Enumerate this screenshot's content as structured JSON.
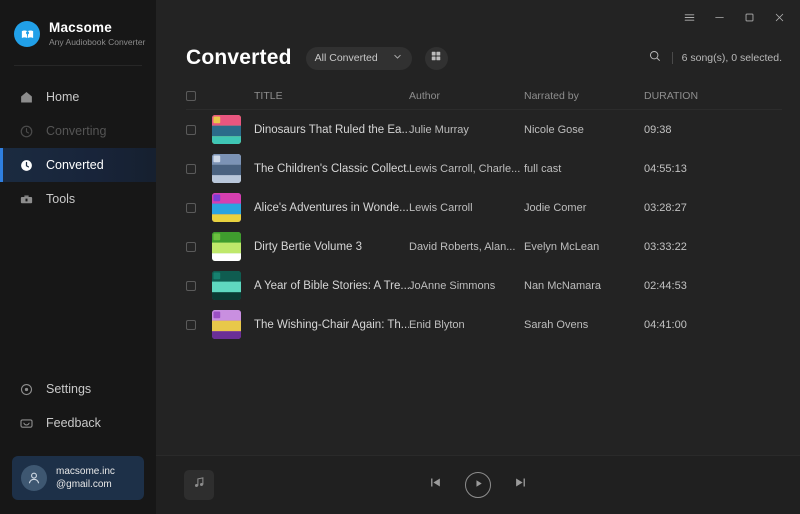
{
  "window": {
    "controls": [
      {
        "name": "menu",
        "glyph": "menu-icon"
      },
      {
        "name": "minimize",
        "glyph": "minimize-icon"
      },
      {
        "name": "maximize",
        "glyph": "maximize-icon"
      },
      {
        "name": "close",
        "glyph": "close-icon"
      }
    ]
  },
  "brand": {
    "name": "Macsome",
    "subtitle": "Any Audiobook Converter",
    "logo_icon": "audiobook-logo-icon",
    "accent": "#21a0e8"
  },
  "sidebar": {
    "items": [
      {
        "label": "Home",
        "icon": "home-icon",
        "state": "normal"
      },
      {
        "label": "Converting",
        "icon": "converting-icon",
        "state": "disabled"
      },
      {
        "label": "Converted",
        "icon": "clock-icon",
        "state": "active"
      },
      {
        "label": "Tools",
        "icon": "toolbox-icon",
        "state": "normal"
      }
    ],
    "bottom_items": [
      {
        "label": "Settings",
        "icon": "gear-icon"
      },
      {
        "label": "Feedback",
        "icon": "feedback-icon"
      }
    ],
    "account": {
      "line1": "macsome.inc",
      "line2": "@gmail.com",
      "avatar_icon": "user-avatar-icon"
    },
    "active_accent": "#2f7fe0"
  },
  "header": {
    "title": "Converted",
    "filter": {
      "selected": "All Converted",
      "chevron_icon": "chevron-down-icon"
    },
    "grid_view_icon": "grid-view-icon",
    "search_icon": "search-icon",
    "count_text": "6 song(s), 0 selected."
  },
  "table": {
    "columns": [
      "TITLE",
      "Author",
      "Narrated by",
      "DURATION"
    ],
    "select_all_checked": false,
    "rows": [
      {
        "title": "Dinosaurs That Ruled the Ea...",
        "author": "Julie Murray",
        "narrated_by": "Nicole Gose",
        "duration": "09:38",
        "checked": false,
        "art": {
          "c1": "#e8c84a",
          "c2": "#e8567f",
          "c3": "#2b6b8a",
          "c4": "#3fc6b5"
        }
      },
      {
        "title": "The Children's Classic Collect...",
        "author": "Lewis Carroll, Charle...",
        "narrated_by": "full cast",
        "duration": "04:55:13",
        "checked": false,
        "art": {
          "c1": "#cfd9e8",
          "c2": "#7c93b5",
          "c3": "#4a6280",
          "c4": "#b9c7da"
        }
      },
      {
        "title": "Alice's Adventures in Wonde...",
        "author": "Lewis Carroll",
        "narrated_by": "Jodie Comer",
        "duration": "03:28:27",
        "checked": false,
        "art": {
          "c1": "#7a3fd6",
          "c2": "#d63fb0",
          "c3": "#2aa3e0",
          "c4": "#e8d23f"
        }
      },
      {
        "title": "Dirty Bertie Volume 3",
        "author": "David Roberts, Alan...",
        "narrated_by": "Evelyn McLean",
        "duration": "03:33:22",
        "checked": false,
        "art": {
          "c1": "#6bbf3f",
          "c2": "#3f9c2e",
          "c3": "#bfe86b",
          "c4": "#ffffff"
        }
      },
      {
        "title": "A Year of Bible Stories: A Tre...",
        "author": "JoAnne Simmons",
        "narrated_by": "Nan McNamara",
        "duration": "02:44:53",
        "checked": false,
        "art": {
          "c1": "#16806f",
          "c2": "#0f5c50",
          "c3": "#5fd8c0",
          "c4": "#0b3a33"
        }
      },
      {
        "title": "The Wishing-Chair Again: Th...",
        "author": "Enid Blyton",
        "narrated_by": "Sarah Ovens",
        "duration": "04:41:00",
        "checked": false,
        "art": {
          "c1": "#9b4fc4",
          "c2": "#c98fe0",
          "c3": "#e8c84a",
          "c4": "#6a2f96"
        }
      }
    ]
  },
  "player": {
    "now_playing_icon": "music-note-icon",
    "previous_icon": "previous-track-icon",
    "play_icon": "play-icon",
    "next_icon": "next-track-icon"
  }
}
